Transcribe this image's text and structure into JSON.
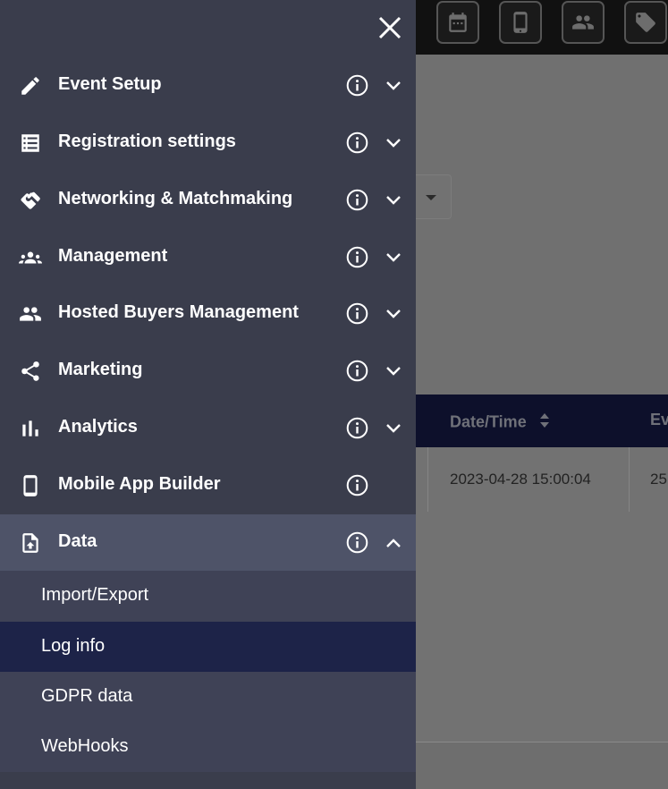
{
  "background": {
    "toolbar_icons": [
      "calendar-icon",
      "mobile-icon",
      "people-icon",
      "tag-icon"
    ],
    "table": {
      "columns": [
        "Date/Time",
        "Ev"
      ],
      "rows": [
        [
          "2023-04-28 15:00:04",
          "25"
        ]
      ]
    }
  },
  "sidebar": {
    "close_icon": "close-icon",
    "items": [
      {
        "label": "Event Setup",
        "icon": "pencil-icon",
        "expanded": false
      },
      {
        "label": "Registration settings",
        "icon": "list-icon",
        "expanded": false
      },
      {
        "label": "Networking & Matchmaking",
        "icon": "handshake-icon",
        "expanded": false
      },
      {
        "label": "Management",
        "icon": "group-icon",
        "expanded": false
      },
      {
        "label": "Hosted Buyers Management",
        "icon": "people-icon",
        "expanded": false
      },
      {
        "label": "Marketing",
        "icon": "share-icon",
        "expanded": false
      },
      {
        "label": "Analytics",
        "icon": "bar-chart-icon",
        "expanded": false
      },
      {
        "label": "Mobile App Builder",
        "icon": "mobile-icon",
        "expanded": null
      },
      {
        "label": "Data",
        "icon": "file-upload-icon",
        "expanded": true
      }
    ],
    "data_submenu": [
      {
        "label": "Import/Export",
        "selected": false
      },
      {
        "label": "Log info",
        "selected": true
      },
      {
        "label": "GDPR data",
        "selected": false
      },
      {
        "label": "WebHooks",
        "selected": false
      }
    ]
  },
  "colors": {
    "sidebar_bg": "#3a3d4c",
    "active_item_bg": "#4e5368",
    "selected_subitem_bg": "#1d2348",
    "table_header_bg": "#0d102b"
  }
}
